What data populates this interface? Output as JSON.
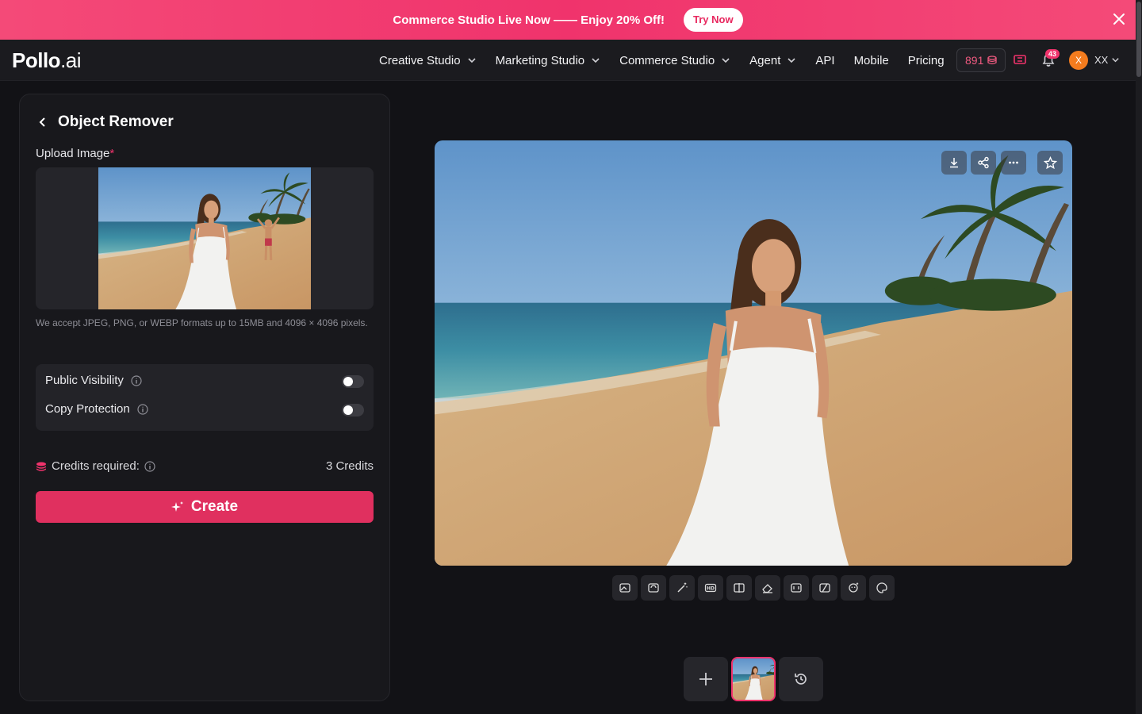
{
  "promo": {
    "text": "Commerce Studio Live Now —— Enjoy 20% Off!",
    "button": "Try Now"
  },
  "nav": {
    "logo_main": "Pollo",
    "logo_suffix": ".ai",
    "items": [
      {
        "label": "Creative Studio",
        "dropdown": true
      },
      {
        "label": "Marketing Studio",
        "dropdown": true
      },
      {
        "label": "Commerce Studio",
        "dropdown": true
      },
      {
        "label": "Agent",
        "dropdown": true
      },
      {
        "label": "API",
        "dropdown": false
      },
      {
        "label": "Mobile",
        "dropdown": false
      },
      {
        "label": "Pricing",
        "dropdown": false
      }
    ],
    "credits": "891",
    "notifications": "43",
    "avatar_initial": "X",
    "user_name": "XX"
  },
  "panel": {
    "title": "Object Remover",
    "upload_label": "Upload Image",
    "required_mark": "*",
    "formats_note": "We accept JPEG, PNG, or WEBP formats up to 15MB and 4096 × 4096 pixels.",
    "public_visibility": "Public Visibility",
    "copy_protection": "Copy Protection",
    "credits_label": "Credits required:",
    "credits_value": "3 Credits",
    "create_button": "Create"
  },
  "colors": {
    "accent": "#e0305f",
    "banner": "#f0336c",
    "background": "#121216",
    "panel": "#18181c"
  },
  "toggles": {
    "public_visibility": false,
    "copy_protection": false
  }
}
